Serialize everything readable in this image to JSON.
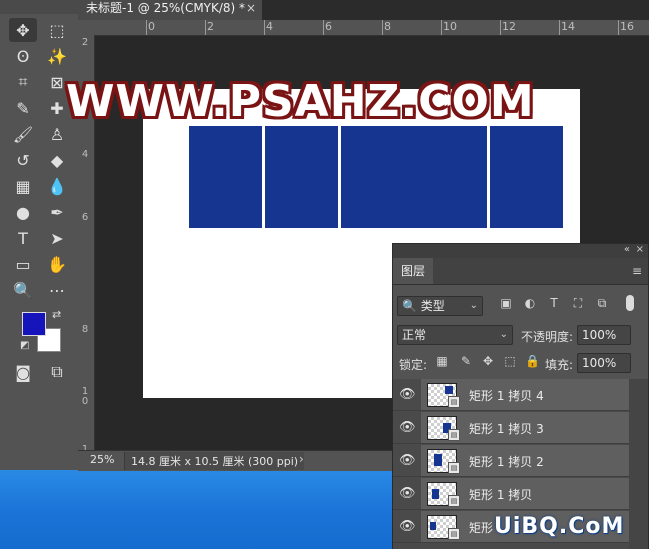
{
  "document": {
    "tab_title": "未标题-1 @ 25%(CMYK/8) *",
    "close_glyph": "×"
  },
  "rulers": {
    "top_labels": [
      "0",
      "2",
      "4",
      "6",
      "8",
      "10",
      "12",
      "14",
      "16"
    ],
    "left_labels": [
      "2",
      "4",
      "6",
      "8",
      "1\n0",
      "1\n2"
    ]
  },
  "watermark_text": "WWW.PSAHZ.COM",
  "colors": {
    "foreground": "#1515bb",
    "background": "#ffffff",
    "rectangle_fill": "#163590",
    "watermark_outline": "#7a1414"
  },
  "status": {
    "zoom": "25%",
    "doc_info": "14.8 厘米 x 10.5 厘米 (300 ppi)",
    "arrow": "›"
  },
  "tools": [
    {
      "name": "move-tool-icon",
      "glyph": "✥",
      "active": true
    },
    {
      "name": "marquee-tool-icon",
      "glyph": "⬚"
    },
    {
      "name": "lasso-tool-icon",
      "glyph": "ʘ"
    },
    {
      "name": "magic-wand-tool-icon",
      "glyph": "✨"
    },
    {
      "name": "crop-tool-icon",
      "glyph": "⌗"
    },
    {
      "name": "frame-tool-icon",
      "glyph": "⊠"
    },
    {
      "name": "eyedropper-tool-icon",
      "glyph": "✎"
    },
    {
      "name": "healing-brush-tool-icon",
      "glyph": "✚"
    },
    {
      "name": "brush-tool-icon",
      "glyph": "🖌"
    },
    {
      "name": "stamp-tool-icon",
      "glyph": "♙"
    },
    {
      "name": "history-brush-tool-icon",
      "glyph": "↺"
    },
    {
      "name": "eraser-tool-icon",
      "glyph": "◆"
    },
    {
      "name": "gradient-tool-icon",
      "glyph": "▦"
    },
    {
      "name": "blur-tool-icon",
      "glyph": "💧"
    },
    {
      "name": "dodge-tool-icon",
      "glyph": "●"
    },
    {
      "name": "pen-tool-icon",
      "glyph": "✒"
    },
    {
      "name": "type-tool-icon",
      "glyph": "T"
    },
    {
      "name": "path-selection-tool-icon",
      "glyph": "➤"
    },
    {
      "name": "rectangle-tool-icon",
      "glyph": "▭"
    },
    {
      "name": "hand-tool-icon",
      "glyph": "✋"
    },
    {
      "name": "zoom-tool-icon",
      "glyph": "🔍"
    },
    {
      "name": "more-tools-icon",
      "glyph": "⋯"
    },
    {
      "name": "quick-mask-icon",
      "glyph": "◙"
    },
    {
      "name": "screen-mode-icon",
      "glyph": "⧉"
    }
  ],
  "layers_panel": {
    "tab_label": "图层",
    "collapse_glyph": "«",
    "close_glyph": "×",
    "menu_glyph": "≡",
    "filter_label": "🔍 类型",
    "blend_mode": "正常",
    "opacity_label": "不透明度:",
    "opacity_value": "100%",
    "lock_label": "锁定:",
    "fill_label": "填充:",
    "fill_value": "100%",
    "filter_icons": [
      "▣",
      "◐",
      "T",
      "⛶",
      "⧉"
    ],
    "lock_icons": [
      "▦",
      "✎",
      "✥",
      "⬚",
      "🔒"
    ],
    "layers": [
      {
        "name": "矩形 1 拷贝 4",
        "visible": true
      },
      {
        "name": "矩形 1 拷贝 3",
        "visible": true
      },
      {
        "name": "矩形 1 拷贝 2",
        "visible": true
      },
      {
        "name": "矩形 1 拷贝",
        "visible": true
      },
      {
        "name": "矩形",
        "visible": true
      }
    ]
  },
  "site_mark": "UiBQ.CoM"
}
